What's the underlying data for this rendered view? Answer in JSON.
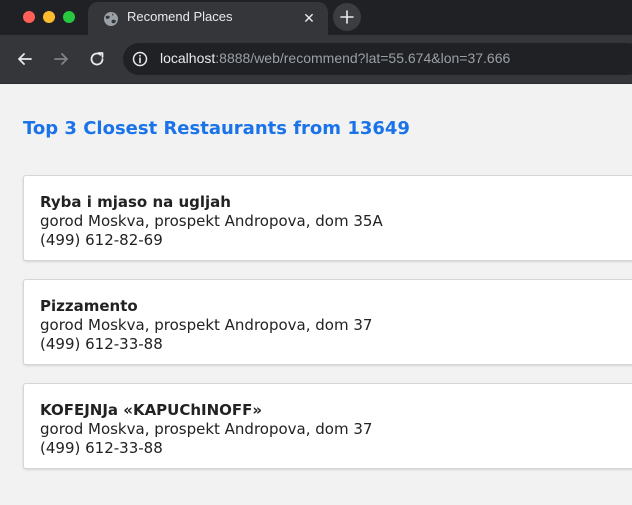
{
  "browser": {
    "tab": {
      "title": "Recomend Places",
      "close_label": "✕",
      "favicon": "globe-icon"
    },
    "new_tab_icon": "plus-icon",
    "nav": {
      "back_icon": "arrow-left-icon",
      "forward_icon": "arrow-right-icon",
      "reload_icon": "reload-icon"
    },
    "address": {
      "host": "localhost",
      "rest": ":8888/web/recommend?lat=55.674&lon=37.666",
      "site_info_icon": "site-info-icon"
    }
  },
  "page": {
    "title": "Top 3 Closest Restaurants from 13649",
    "title_color": "#1a73e8",
    "restaurants": [
      {
        "name": "Ryba i mjaso na ugljah",
        "address": "gorod Moskva, prospekt Andropova, dom 35A",
        "phone": "(499) 612-82-69"
      },
      {
        "name": "Pizzamento",
        "address": "gorod Moskva, prospekt Andropova, dom 37",
        "phone": "(499) 612-33-88"
      },
      {
        "name": "KOFEJNJa «KAPUChINOFF»",
        "address": "gorod Moskva, prospekt Andropova, dom 37",
        "phone": "(499) 612-33-88"
      }
    ]
  }
}
